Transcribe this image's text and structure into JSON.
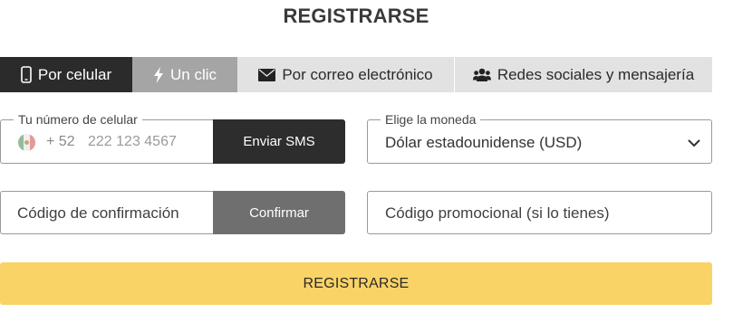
{
  "page": {
    "title": "REGISTRARSE"
  },
  "tabs": [
    {
      "label": "Por celular",
      "icon": "phone-icon",
      "state": "active"
    },
    {
      "label": "Un clic",
      "icon": "lightning-icon",
      "state": "inactive"
    },
    {
      "label": "Por correo electrónico",
      "icon": "envelope-icon",
      "state": "inactive"
    },
    {
      "label": "Redes sociales y mensajería",
      "icon": "users-icon",
      "state": "inactive"
    }
  ],
  "phone": {
    "legend": "Tu número de celular",
    "flag_icon": "mexico-flag-icon",
    "prefix": "+ 52",
    "placeholder": "222 123 4567",
    "send_label": "Enviar SMS"
  },
  "currency": {
    "legend": "Elige la moneda",
    "value": "Dólar estadounidense (USD)",
    "icon": "chevron-down-icon"
  },
  "confirmation": {
    "placeholder": "Código de confirmación",
    "confirm_label": "Confirmar"
  },
  "promo": {
    "placeholder": "Código promocional (si lo tienes)"
  },
  "register": {
    "label": "REGISTRARSE"
  },
  "colors": {
    "active_tab": "#2b2b2b",
    "secondary_tab": "#a5a5a5",
    "inactive_tab": "#e2e2e2",
    "sms_button": "#2d2d2d",
    "confirm_button": "#6f6f6f",
    "register_button": "#fad366"
  }
}
